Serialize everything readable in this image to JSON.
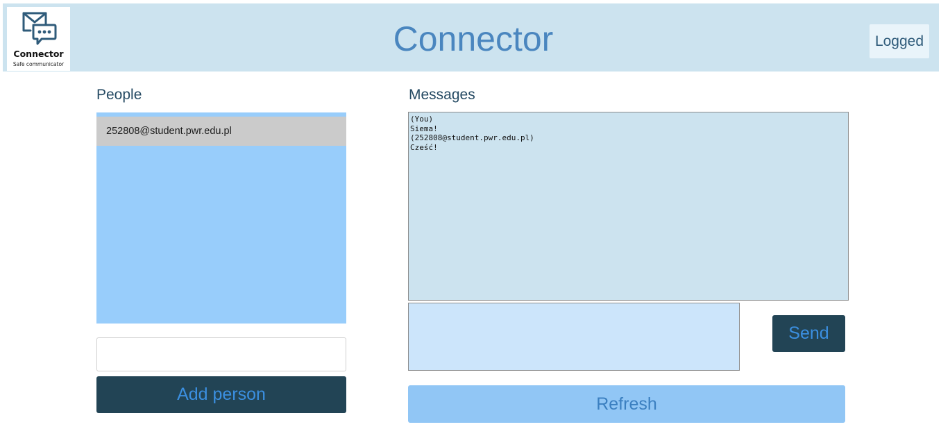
{
  "logo": {
    "name": "Connector",
    "tagline": "Safe communicator",
    "icon": "mail-chat-icon"
  },
  "header": {
    "title": "Connector",
    "logged_label": "Logged"
  },
  "people": {
    "heading": "People",
    "items": [
      {
        "email": "252808@student.pwr.edu.pl",
        "selected": true
      }
    ],
    "input_value": "",
    "add_button_label": "Add person"
  },
  "messages": {
    "heading": "Messages",
    "lines": [
      "(You)",
      "Siema!",
      "(252808@student.pwr.edu.pl)",
      "Cześć!"
    ],
    "compose_value": "",
    "send_label": "Send",
    "refresh_label": "Refresh"
  },
  "colors": {
    "header_bg": "#cce3ef",
    "title": "#4a86bf",
    "people_list_bg": "#98cdfb",
    "selected_item_bg": "#cbcbcb",
    "button_dark": "#224455",
    "button_text": "#3b8fe0",
    "refresh_bg": "#91c6f5"
  }
}
